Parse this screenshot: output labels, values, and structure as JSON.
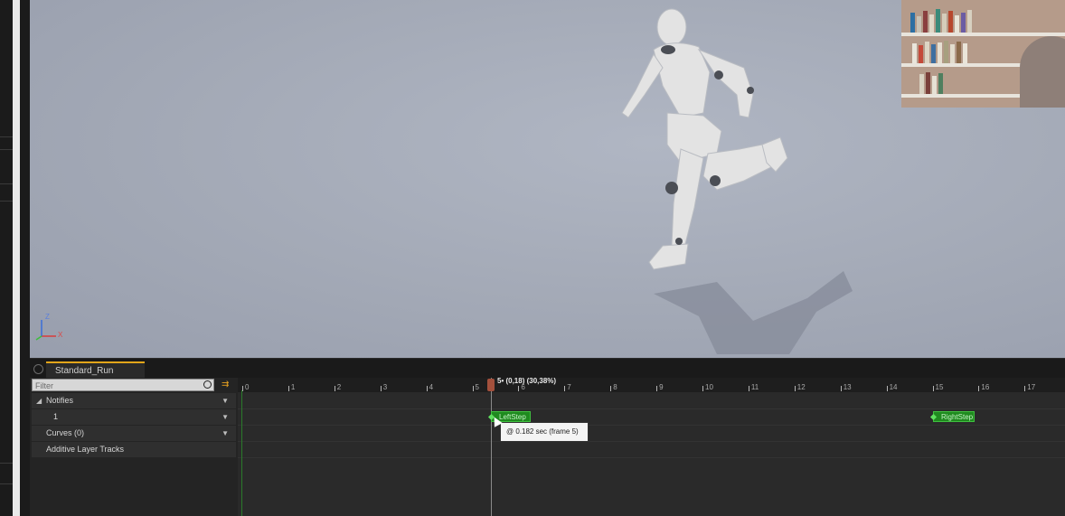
{
  "viewport": {
    "axis_z": "Z",
    "axis_x": "X",
    "axis_y": "Y"
  },
  "tab": {
    "title": "Standard_Run"
  },
  "tracks_panel": {
    "filter_placeholder": "Filter",
    "rows": [
      {
        "label": "Notifies",
        "collapsible": true
      },
      {
        "label": "1"
      },
      {
        "label": "Curves  (0)"
      },
      {
        "label": "Additive Layer Tracks"
      }
    ]
  },
  "timeline": {
    "scrubber_label": "5• (0,18) (30,38%)",
    "frame_labels": [
      "0",
      "1",
      "2",
      "3",
      "4",
      "5",
      "6",
      "7",
      "8",
      "9",
      "10",
      "11",
      "12",
      "13",
      "14",
      "15",
      "16",
      "17"
    ],
    "notifies": [
      {
        "label": "LeftStep",
        "frame": 5.5
      },
      {
        "label": "RightStep",
        "frame": 15
      }
    ],
    "tooltip": "@ 0.182 sec (frame 5)"
  },
  "colors": {
    "accent": "#e2a51a",
    "notify": "#1f8a1f",
    "scrubber": "#a3503c"
  }
}
